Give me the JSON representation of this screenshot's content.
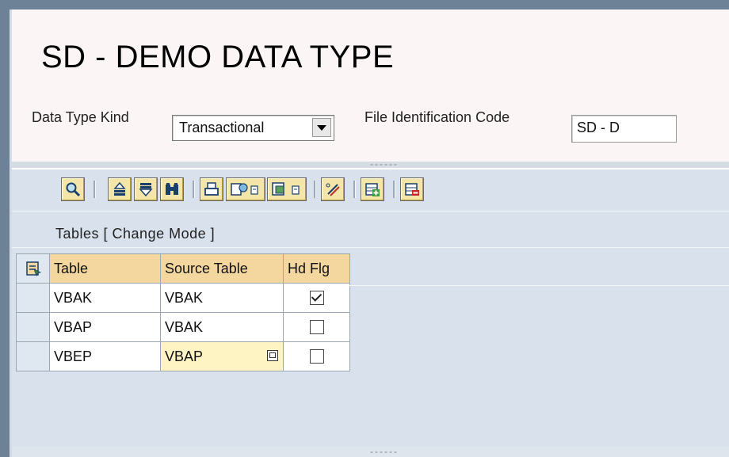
{
  "header": {
    "title": "SD - DEMO DATA TYPE",
    "data_type_kind_label": "Data Type Kind",
    "data_type_kind_value": "Transactional",
    "file_id_label": "File Identification Code",
    "file_id_value": "SD - D"
  },
  "toolbar": {
    "icons": [
      "details-icon",
      "sort-ascending-icon",
      "filter-icon",
      "find-icon",
      "print-icon",
      "export-icon",
      "view-icon",
      "edit-icon",
      "insert-row-icon",
      "delete-row-icon"
    ]
  },
  "grid": {
    "title": "Tables [ Change Mode ]",
    "columns": [
      "Table",
      "Source Table",
      "Hd Flg"
    ],
    "rows": [
      {
        "table": "VBAK",
        "source": "VBAK",
        "hd_flg": true
      },
      {
        "table": "VBAP",
        "source": "VBAK",
        "hd_flg": false
      },
      {
        "table": "VBEP",
        "source": "VBAP",
        "hd_flg": false
      }
    ]
  },
  "colors": {
    "frame": "#6d8296",
    "header_bg": "#fbf5f5",
    "panel_bg": "#d9e1ec",
    "column_header_bg": "#f3d79e",
    "active_cell_bg": "#fef4c3",
    "toolbar_button_bg": "#f3e6a8"
  }
}
